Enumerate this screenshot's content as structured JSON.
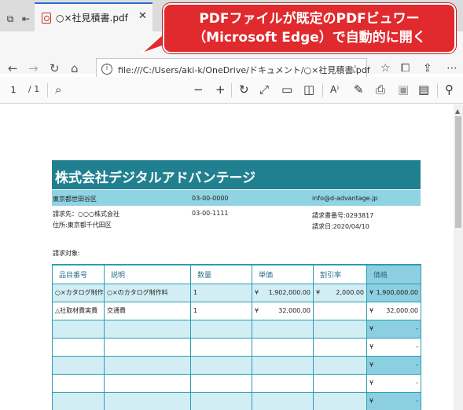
{
  "browser": {
    "tab_title": "○×社見積書.pdf",
    "url": "file:///C:/Users/aki-k/OneDrive/ドキュメント/○×社見積書.pdf"
  },
  "callout": {
    "line1": "PDFファイルが既定のPDFビュワー",
    "line2": "（Microsoft Edge）で自動的に開く"
  },
  "pdf_toolbar": {
    "page_current": "1",
    "page_total": "/ 1"
  },
  "document": {
    "company_title": "株式会社デジタルアドバンテージ",
    "band": {
      "address": "東京都世田谷区",
      "phone": "03-00-0000",
      "email": "info@d-advantage.jp"
    },
    "recipient": "請求先：○○○株式会社",
    "recipient_address": "住所:東京都千代田区",
    "recipient_phone": "03-00-1111",
    "invoice_no": "請求書番号:0293817",
    "invoice_date": "請求日:2020/04/10",
    "target_label": "請求対象:",
    "table": {
      "headers": [
        "品目番号",
        "説明",
        "数量",
        "単価",
        "割引率",
        "価格"
      ],
      "rows": [
        {
          "item": "○×カタログ制作費",
          "desc": "○×のカタログ制作料",
          "qty": "1",
          "unit_cur": "¥",
          "unit": "1,902,000.00",
          "disc_cur": "¥",
          "disc": "2,000.00",
          "price_cur": "¥",
          "price": "1,900,000.00"
        },
        {
          "item": "△社取材費実費",
          "desc": "交通費",
          "qty": "1",
          "unit_cur": "¥",
          "unit": "32,000.00",
          "disc_cur": "",
          "disc": "",
          "price_cur": "¥",
          "price": "32,000.00"
        },
        {
          "item": "",
          "desc": "",
          "qty": "",
          "unit_cur": "",
          "unit": "",
          "disc_cur": "",
          "disc": "",
          "price_cur": "¥",
          "price": "-"
        },
        {
          "item": "",
          "desc": "",
          "qty": "",
          "unit_cur": "",
          "unit": "",
          "disc_cur": "",
          "disc": "",
          "price_cur": "¥",
          "price": "-"
        },
        {
          "item": "",
          "desc": "",
          "qty": "",
          "unit_cur": "",
          "unit": "",
          "disc_cur": "",
          "disc": "",
          "price_cur": "¥",
          "price": "-"
        },
        {
          "item": "",
          "desc": "",
          "qty": "",
          "unit_cur": "",
          "unit": "",
          "disc_cur": "",
          "disc": "",
          "price_cur": "¥",
          "price": "-"
        },
        {
          "item": "",
          "desc": "",
          "qty": "",
          "unit_cur": "",
          "unit": "",
          "disc_cur": "",
          "disc": "",
          "price_cur": "¥",
          "price": "-"
        }
      ]
    }
  },
  "colors": {
    "accent_blue": "#2b6ad1",
    "callout_red": "#e02a2d",
    "doc_header_teal": "#21808f",
    "doc_band": "#90d3e3",
    "row_alt": "#d2eef4",
    "price_col": "#8ccfe0"
  },
  "icons": [
    "tab-list-icon",
    "tab-back-icon",
    "pdf-file-icon",
    "close-icon",
    "back-arrow-icon",
    "forward-arrow-icon",
    "refresh-icon",
    "home-icon",
    "file-info-icon",
    "favorite-star-icon",
    "reading-list-icon",
    "collections-icon",
    "share-icon",
    "settings-icon",
    "search-icon",
    "zoom-out-icon",
    "zoom-in-icon",
    "rotate-icon",
    "fit-page-icon",
    "page-view-icon",
    "two-page-icon",
    "read-aloud-icon",
    "draw-icon",
    "print-icon",
    "save-icon",
    "save-as-icon",
    "pin-icon"
  ]
}
